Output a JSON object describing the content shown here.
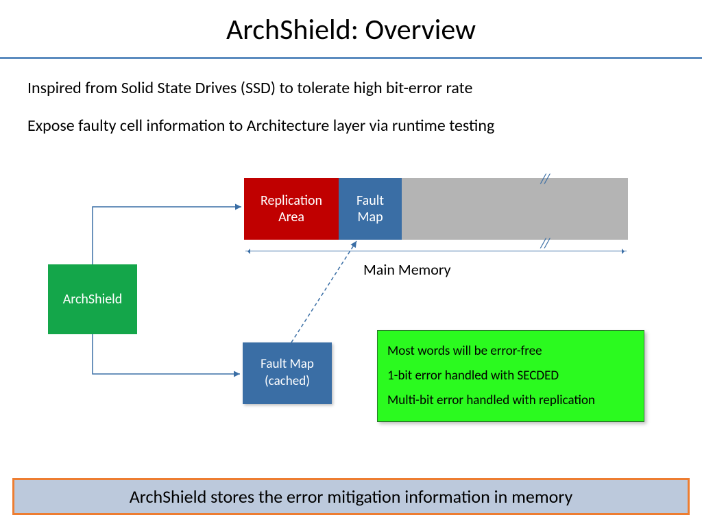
{
  "title": "ArchShield: Overview",
  "bullets": [
    "Inspired from Solid State Drives (SSD) to tolerate high bit-error rate",
    "Expose faulty cell information to Architecture layer via runtime testing"
  ],
  "diagram": {
    "archshield_label": "ArchShield",
    "memory": {
      "replication": "Replication\nArea",
      "fault_map": "Fault\nMap",
      "label": "Main Memory"
    },
    "fault_map_cached": "Fault Map\n(cached)",
    "callout": {
      "line1": "Most words will be error-free",
      "line2": "1-bit error handled with SECDED",
      "line3": "Multi-bit error handled with replication"
    }
  },
  "summary": "ArchShield stores the error mitigation information in memory"
}
